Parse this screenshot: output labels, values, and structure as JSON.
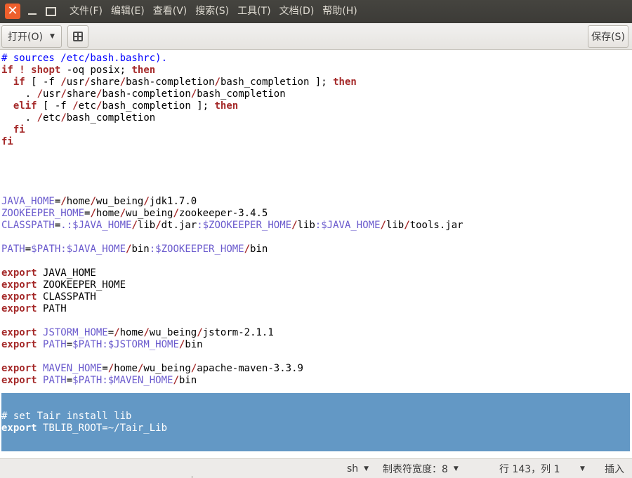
{
  "window": {
    "menus": [
      "文件(F)",
      "编辑(E)",
      "查看(V)",
      "搜索(S)",
      "工具(T)",
      "文档(D)",
      "帮助(H)"
    ]
  },
  "toolbar": {
    "open_label": "打开(O)",
    "save_label": "保存(S)"
  },
  "editor": {
    "lines": [
      [
        [
          "comment",
          "# sources /etc/bash.bashrc)."
        ]
      ],
      [
        [
          "kw",
          "if"
        ],
        [
          "plain",
          " "
        ],
        [
          "kw",
          "!"
        ],
        [
          "plain",
          " "
        ],
        [
          "kw",
          "shopt"
        ],
        [
          "plain",
          " -oq posix; "
        ],
        [
          "kw",
          "then"
        ]
      ],
      [
        [
          "plain",
          "  "
        ],
        [
          "kw",
          "if"
        ],
        [
          "plain",
          " [ -f "
        ],
        [
          "path",
          "/"
        ],
        [
          "plain",
          "usr"
        ],
        [
          "path",
          "/"
        ],
        [
          "plain",
          "share"
        ],
        [
          "path",
          "/"
        ],
        [
          "plain",
          "bash-completion"
        ],
        [
          "path",
          "/"
        ],
        [
          "plain",
          "bash_completion ]; "
        ],
        [
          "kw",
          "then"
        ]
      ],
      [
        [
          "plain",
          "    . "
        ],
        [
          "path",
          "/"
        ],
        [
          "plain",
          "usr"
        ],
        [
          "path",
          "/"
        ],
        [
          "plain",
          "share"
        ],
        [
          "path",
          "/"
        ],
        [
          "plain",
          "bash-completion"
        ],
        [
          "path",
          "/"
        ],
        [
          "plain",
          "bash_completion"
        ]
      ],
      [
        [
          "plain",
          "  "
        ],
        [
          "kw",
          "elif"
        ],
        [
          "plain",
          " [ -f "
        ],
        [
          "path",
          "/"
        ],
        [
          "plain",
          "etc"
        ],
        [
          "path",
          "/"
        ],
        [
          "plain",
          "bash_completion ]; "
        ],
        [
          "kw",
          "then"
        ]
      ],
      [
        [
          "plain",
          "    . "
        ],
        [
          "path",
          "/"
        ],
        [
          "plain",
          "etc"
        ],
        [
          "path",
          "/"
        ],
        [
          "plain",
          "bash_completion"
        ]
      ],
      [
        [
          "plain",
          "  "
        ],
        [
          "kw",
          "fi"
        ]
      ],
      [
        [
          "kw",
          "fi"
        ]
      ],
      [],
      [],
      [],
      [],
      [
        [
          "var",
          "JAVA_HOME"
        ],
        [
          "plain",
          "="
        ],
        [
          "path",
          "/"
        ],
        [
          "plain",
          "home"
        ],
        [
          "path",
          "/"
        ],
        [
          "plain",
          "wu_being"
        ],
        [
          "path",
          "/"
        ],
        [
          "plain",
          "jdk1.7.0"
        ]
      ],
      [
        [
          "var",
          "ZOOKEEPER_HOME"
        ],
        [
          "plain",
          "="
        ],
        [
          "path",
          "/"
        ],
        [
          "plain",
          "home"
        ],
        [
          "path",
          "/"
        ],
        [
          "plain",
          "wu_being"
        ],
        [
          "path",
          "/"
        ],
        [
          "plain",
          "zookeeper-3.4.5"
        ]
      ],
      [
        [
          "var",
          "CLASSPATH"
        ],
        [
          "plain",
          "="
        ],
        [
          "var",
          ".:$JAVA_HOME"
        ],
        [
          "path",
          "/"
        ],
        [
          "plain",
          "lib"
        ],
        [
          "path",
          "/"
        ],
        [
          "plain",
          "dt.jar"
        ],
        [
          "var",
          ":$ZOOKEEPER_HOME"
        ],
        [
          "path",
          "/"
        ],
        [
          "plain",
          "lib"
        ],
        [
          "var",
          ":$JAVA_HOME"
        ],
        [
          "path",
          "/"
        ],
        [
          "plain",
          "lib"
        ],
        [
          "path",
          "/"
        ],
        [
          "plain",
          "tools.jar"
        ]
      ],
      [],
      [
        [
          "var",
          "PATH"
        ],
        [
          "plain",
          "="
        ],
        [
          "var",
          "$PATH:$JAVA_HOME"
        ],
        [
          "path",
          "/"
        ],
        [
          "plain",
          "bin"
        ],
        [
          "var",
          ":$ZOOKEEPER_HOME"
        ],
        [
          "path",
          "/"
        ],
        [
          "plain",
          "bin"
        ]
      ],
      [],
      [
        [
          "kw",
          "export"
        ],
        [
          "plain",
          " JAVA_HOME"
        ]
      ],
      [
        [
          "kw",
          "export"
        ],
        [
          "plain",
          " ZOOKEEPER_HOME"
        ]
      ],
      [
        [
          "kw",
          "export"
        ],
        [
          "plain",
          " CLASSPATH"
        ]
      ],
      [
        [
          "kw",
          "export"
        ],
        [
          "plain",
          " PATH"
        ]
      ],
      [],
      [
        [
          "kw",
          "export"
        ],
        [
          "plain",
          " "
        ],
        [
          "var",
          "JSTORM_HOME"
        ],
        [
          "plain",
          "="
        ],
        [
          "path",
          "/"
        ],
        [
          "plain",
          "home"
        ],
        [
          "path",
          "/"
        ],
        [
          "plain",
          "wu_being"
        ],
        [
          "path",
          "/"
        ],
        [
          "plain",
          "jstorm-2.1.1"
        ]
      ],
      [
        [
          "kw",
          "export"
        ],
        [
          "plain",
          " "
        ],
        [
          "var",
          "PATH"
        ],
        [
          "plain",
          "="
        ],
        [
          "var",
          "$PATH:$JSTORM_HOME"
        ],
        [
          "path",
          "/"
        ],
        [
          "plain",
          "bin"
        ]
      ],
      [],
      [
        [
          "kw",
          "export"
        ],
        [
          "plain",
          " "
        ],
        [
          "var",
          "MAVEN_HOME"
        ],
        [
          "plain",
          "="
        ],
        [
          "path",
          "/"
        ],
        [
          "plain",
          "home"
        ],
        [
          "path",
          "/"
        ],
        [
          "plain",
          "wu_being"
        ],
        [
          "path",
          "/"
        ],
        [
          "plain",
          "apache-maven-3.3.9"
        ]
      ],
      [
        [
          "kw",
          "export"
        ],
        [
          "plain",
          " "
        ],
        [
          "var",
          "PATH"
        ],
        [
          "plain",
          "="
        ],
        [
          "var",
          "$PATH:$MAVEN_HOME"
        ],
        [
          "path",
          "/"
        ],
        [
          "plain",
          "bin"
        ]
      ],
      [],
      [],
      [
        [
          "sel-comment",
          "# set Tair install lib"
        ]
      ],
      [
        [
          "sel-kw",
          "export"
        ],
        [
          "sel-plain",
          " TBLIB_ROOT=~/Tair_Lib"
        ]
      ]
    ],
    "selected_lines": [
      30,
      31
    ]
  },
  "statusbar": {
    "language": "sh",
    "tab_width": "制表符宽度：8",
    "cursor": "行 143，列 1",
    "mode": "插入"
  },
  "colors": {
    "selection": "#6398c5",
    "keyword": "#a52a2a",
    "variable": "#6a5acd",
    "comment": "#0000ff",
    "close_button": "#ee5f2c"
  }
}
